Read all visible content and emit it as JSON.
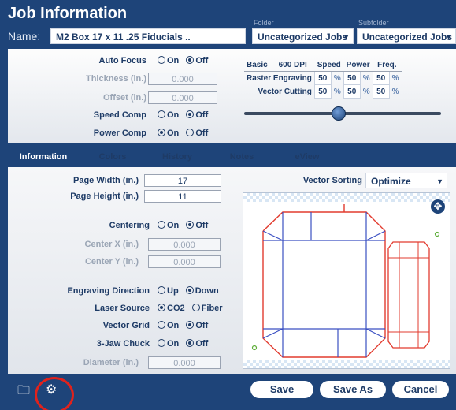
{
  "header": {
    "title": "Job Information",
    "name_label": "Name:",
    "name_value": "M2 Box 17 x 11 .25 Fiducials ..",
    "folder_label": "Folder",
    "folder_value": "Uncategorized Jobs",
    "subfolder_label": "Subfolder",
    "subfolder_value": "Uncategorized Jobs"
  },
  "settings": {
    "auto_focus": {
      "label": "Auto Focus",
      "options": [
        "On",
        "Off"
      ],
      "selected": "Off"
    },
    "thickness": {
      "label": "Thickness (in.)",
      "value": "0.000"
    },
    "offset": {
      "label": "Offset (in.)",
      "value": "0.000"
    },
    "speed_comp": {
      "label": "Speed Comp",
      "options": [
        "On",
        "Off"
      ],
      "selected": "Off"
    },
    "power_comp": {
      "label": "Power Comp",
      "options": [
        "On",
        "Off"
      ],
      "selected": "On"
    }
  },
  "laser_table": {
    "mode": "Basic",
    "dpi": "600 DPI",
    "headers": [
      "Speed",
      "Power",
      "Freq."
    ],
    "rows": [
      {
        "label": "Raster Engraving",
        "speed": "50",
        "power": "50",
        "freq": "50"
      },
      {
        "label": "Vector Cutting",
        "speed": "50",
        "power": "50",
        "freq": "50"
      }
    ],
    "unit": "%",
    "slider_level": 0.48
  },
  "tabs": [
    "Information",
    "Colors",
    "History",
    "Notes",
    "eView"
  ],
  "active_tab": "Information",
  "info": {
    "page_width": {
      "label": "Page Width (in.)",
      "value": "17"
    },
    "page_height": {
      "label": "Page Height (in.)",
      "value": "11"
    },
    "centering": {
      "label": "Centering",
      "options": [
        "On",
        "Off"
      ],
      "selected": "Off"
    },
    "center_x": {
      "label": "Center X (in.)",
      "value": "0.000"
    },
    "center_y": {
      "label": "Center Y (in.)",
      "value": "0.000"
    },
    "engraving_direction": {
      "label": "Engraving Direction",
      "options": [
        "Up",
        "Down"
      ],
      "selected": "Down"
    },
    "laser_source": {
      "label": "Laser Source",
      "options": [
        "CO2",
        "Fiber"
      ],
      "selected": "CO2"
    },
    "vector_grid": {
      "label": "Vector Grid",
      "options": [
        "On",
        "Off"
      ],
      "selected": "Off"
    },
    "jaw_chuck": {
      "label": "3-Jaw Chuck",
      "options": [
        "On",
        "Off"
      ],
      "selected": "Off"
    },
    "diameter": {
      "label": "Diameter (in.)",
      "value": "0.000"
    },
    "vector_sorting_label": "Vector Sorting",
    "vector_sorting_value": "Optimize"
  },
  "footer": {
    "save": "Save",
    "save_as": "Save As",
    "cancel": "Cancel"
  },
  "colors": {
    "brand_blue": "#1e4479",
    "cut_red": "#e23b2f",
    "score_blue": "#3a4fc2",
    "highlight_red": "#e0221c"
  }
}
